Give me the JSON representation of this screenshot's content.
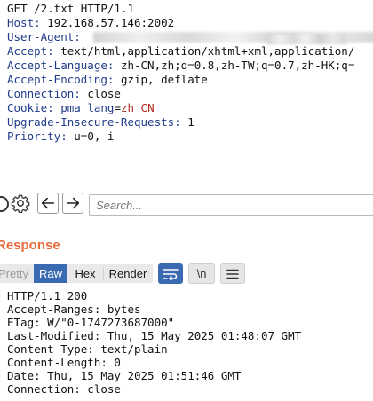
{
  "request": {
    "request_line": "GET /2.txt HTTP/1.1",
    "headers": [
      {
        "name": "Host",
        "value": "192.168.57.146:2002"
      },
      {
        "name": "User-Agent",
        "value": ""
      },
      {
        "name": "Accept",
        "value": "text/html,application/xhtml+xml,application/"
      },
      {
        "name": "Accept-Language",
        "value": "zh-CN,zh;q=0.8,zh-TW;q=0.7,zh-HK;q="
      },
      {
        "name": "Accept-Encoding",
        "value": "gzip, deflate"
      },
      {
        "name": "Connection",
        "value": "close"
      },
      {
        "name": "Cookie",
        "cookie_name": "pma_lang",
        "cookie_value": "zh_CN"
      },
      {
        "name": "Upgrade-Insecure-Requests",
        "value": "1"
      },
      {
        "name": "Priority",
        "value": "u=0, i"
      }
    ]
  },
  "search": {
    "placeholder": "Search..."
  },
  "toolbar_icons": [
    "help-icon",
    "gear-icon",
    "arrow-left-icon",
    "arrow-right-icon"
  ],
  "response": {
    "title": "Response",
    "tabs": [
      "Pretty",
      "Raw",
      "Hex",
      "Render"
    ],
    "active_tab": "Raw",
    "newline_button_label": "\\n",
    "lines": [
      "HTTP/1.1 200",
      "Accept-Ranges: bytes",
      "ETag: W/\"0-1747273687000\"",
      "Last-Modified: Thu, 15 May 2025 01:48:07 GMT",
      "Content-Type: text/plain",
      "Content-Length: 0",
      "Date: Thu, 15 May 2025 01:51:46 GMT",
      "Connection: close"
    ]
  },
  "colors": {
    "header_key": "#1f3b8a",
    "cookie_value": "#b02a1f",
    "accent_orange": "#e8693a",
    "active_blue": "#3a6ab2"
  }
}
